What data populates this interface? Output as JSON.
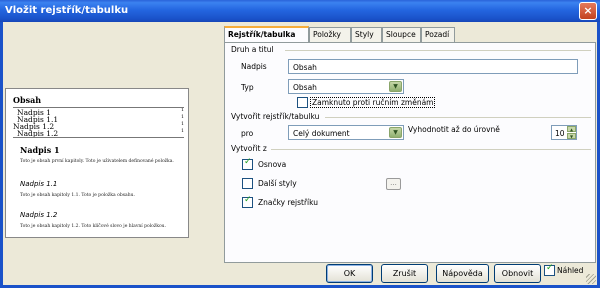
{
  "window": {
    "title": "Vložit rejstřík/tabulku"
  },
  "titlebar": {
    "close_glyph": "×"
  },
  "preview": {
    "title": "Obsah",
    "toc": [
      {
        "label": "Nadpis 1",
        "page": "1"
      },
      {
        "label": "Nadpis 1.1",
        "page": "1"
      },
      {
        "label": "Nadpis 1.2",
        "page": "1"
      },
      {
        "label": "Nadpis 1.2",
        "page": "1"
      }
    ],
    "h1": "Nadpis 1",
    "p1": "Toto je obsah první kapitoly. Toto je uživatelem definované položka.",
    "h11": "Nadpis 1.1",
    "p11": "Toto je obsah kapitoly 1.1. Toto je položka obsahu.",
    "h12": "Nadpis 1.2",
    "p12": "Toto je obsah kapitoly 1.2. Toto klíčové slovo je hlavní položkou."
  },
  "tabs": [
    {
      "label": "Rejstřík/tabulka",
      "active": true
    },
    {
      "label": "Položky",
      "active": false
    },
    {
      "label": "Styly",
      "active": false
    },
    {
      "label": "Sloupce",
      "active": false
    },
    {
      "label": "Pozadí",
      "active": false
    }
  ],
  "type_title": {
    "section_label": "Druh a titul",
    "title_label": "Nadpis",
    "title_value": "Obsah",
    "type_label": "Typ",
    "type_value": "Obsah",
    "protect_label": "Zamknuto proti ručním změnám",
    "protect_checked": false
  },
  "create_index": {
    "section_label": "Vytvořit rejstřík/tabulku",
    "for_label": "pro",
    "for_value": "Celý dokument",
    "eval_label": "Vyhodnotit až do úrovně",
    "level_value": "10"
  },
  "create_from": {
    "section_label": "Vytvořit z",
    "outline_label": "Osnova",
    "outline_checked": true,
    "styles_label": "Další styly",
    "styles_checked": false,
    "styles_btn": "...",
    "marks_label": "Značky rejstříku",
    "marks_checked": true
  },
  "buttons": {
    "ok": "OK",
    "cancel": "Zrušit",
    "help": "Nápověda",
    "reset": "Obnovit",
    "preview_label": "Náhled",
    "preview_checked": true
  },
  "colors": {
    "titlebar": "#2466e0",
    "dialog_bg": "#ece9d8",
    "active_tab_accent": "#f6ad3a"
  }
}
